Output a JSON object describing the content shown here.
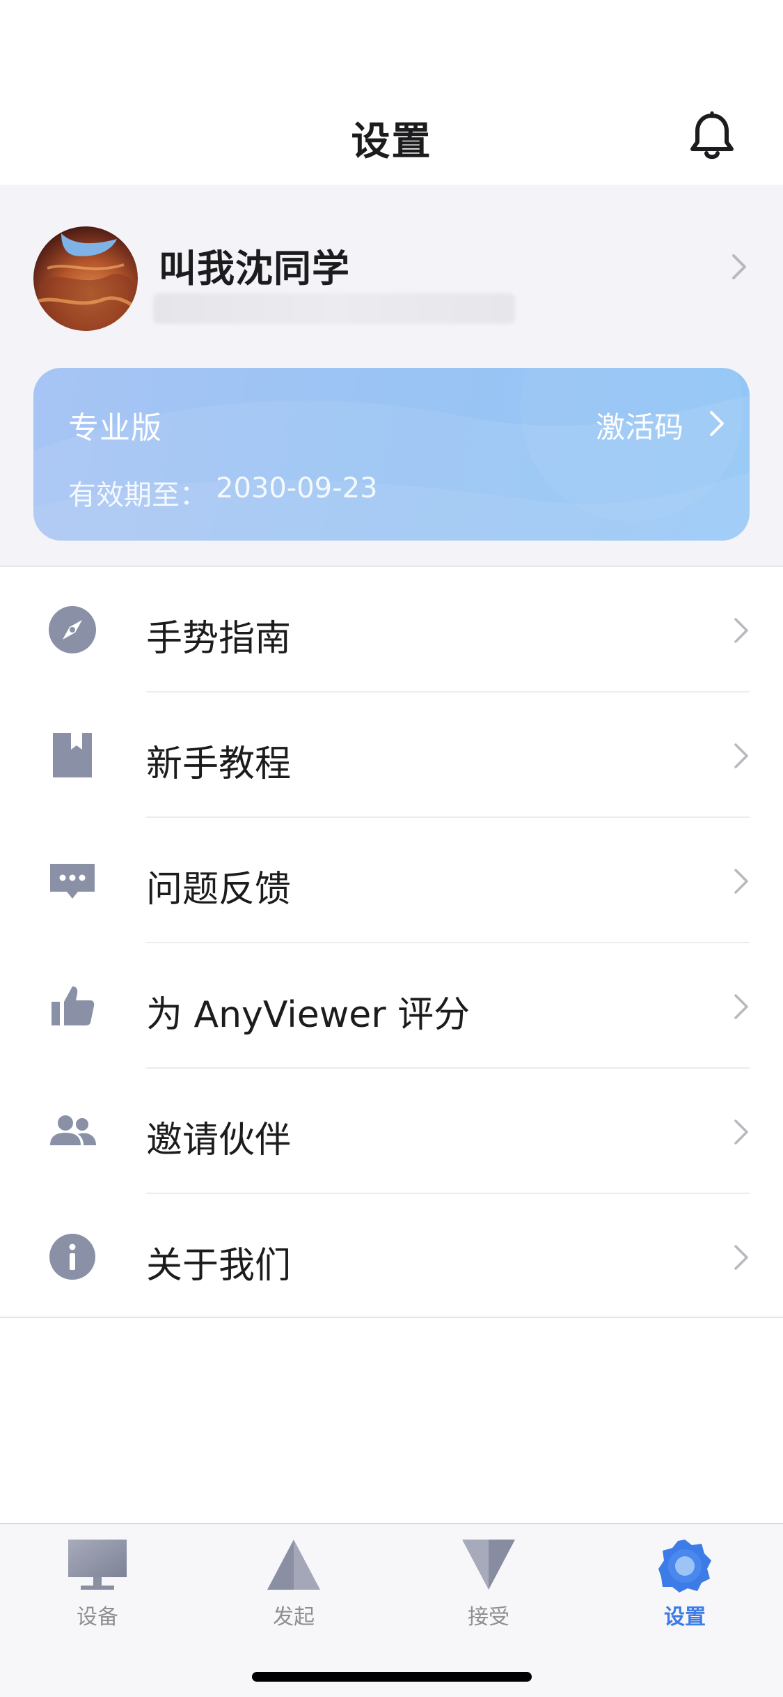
{
  "header": {
    "title": "设置",
    "notification_icon": "bell-icon"
  },
  "profile": {
    "username": "叫我沈同学",
    "avatar_icon": "avatar-image",
    "chevron_icon": "chevron-right-icon"
  },
  "subscription": {
    "plan": "专业版",
    "expiry_label": "有效期至：",
    "expiry_date": "2030-09-23",
    "activation_label": "激活码",
    "card_color": "#9bc4f4"
  },
  "menu": {
    "items": [
      {
        "label": "手势指南",
        "icon": "compass-icon"
      },
      {
        "label": "新手教程",
        "icon": "bookmark-icon"
      },
      {
        "label": "问题反馈",
        "icon": "chat-bubble-icon"
      },
      {
        "label": "为 AnyViewer 评分",
        "icon": "thumbs-up-icon"
      },
      {
        "label": "邀请伙伴",
        "icon": "people-icon"
      },
      {
        "label": "关于我们",
        "icon": "info-icon"
      }
    ]
  },
  "tabbar": {
    "tabs": [
      {
        "label": "设备",
        "icon": "monitor-icon",
        "active": false
      },
      {
        "label": "发起",
        "icon": "triangle-up-icon",
        "active": false
      },
      {
        "label": "接受",
        "icon": "triangle-down-icon",
        "active": false
      },
      {
        "label": "设置",
        "icon": "gear-icon",
        "active": true
      }
    ],
    "active_color": "#3d7be6",
    "inactive_color": "#8e8e93"
  }
}
